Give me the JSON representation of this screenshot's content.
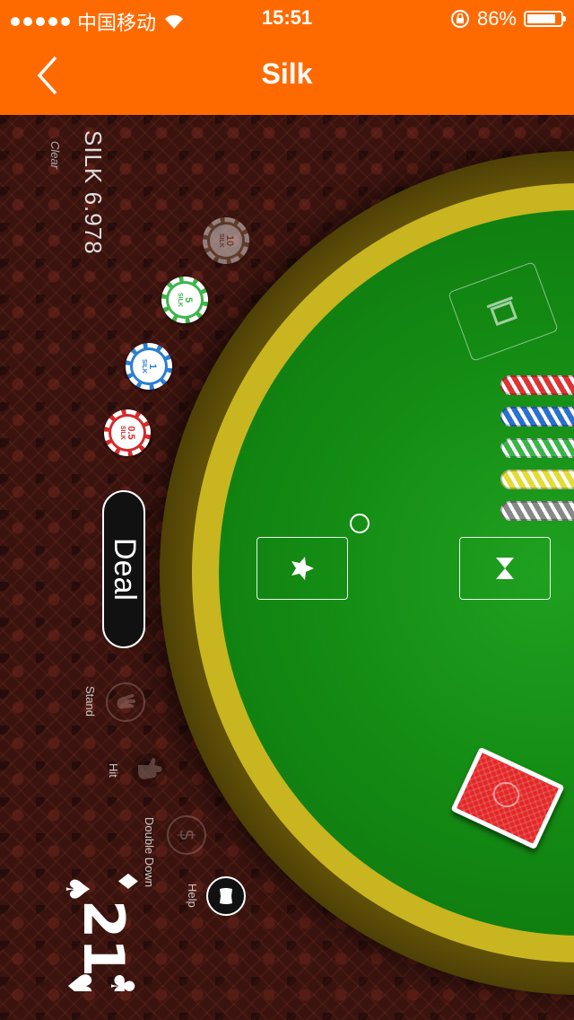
{
  "status": {
    "carrier": "中国移动",
    "time": "15:51",
    "battery": "86%",
    "battery_level": 0.86
  },
  "nav": {
    "title": "Silk"
  },
  "game": {
    "balance": "SILK 6.978",
    "clear_label": "Clear",
    "chips": [
      {
        "value": "10",
        "unit": "SILK",
        "color": "#8a6a4a"
      },
      {
        "value": "5",
        "unit": "SILK",
        "color": "#3db54a"
      },
      {
        "value": "1",
        "unit": "SILK",
        "color": "#2b7fd1"
      },
      {
        "value": "0.5",
        "unit": "SILK",
        "color": "#d62a2a"
      }
    ],
    "deal_label": "Deal",
    "actions": {
      "stand": "Stand",
      "hit": "Hit",
      "double_down": "Double Down",
      "help": "Help"
    },
    "logo_text": "21",
    "stack_colors": [
      "#d33",
      "#2b6fd1",
      "#3bb54a",
      "#e4dc33",
      "#888"
    ]
  }
}
